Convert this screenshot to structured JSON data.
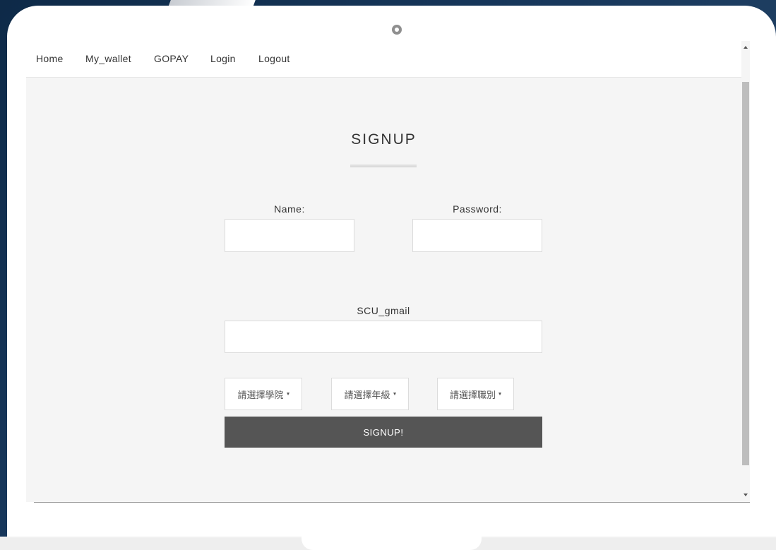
{
  "nav": {
    "items": [
      "Home",
      "My_wallet",
      "GOPAY",
      "Login",
      "Logout"
    ]
  },
  "form": {
    "title": "SIGNUP",
    "name_label": "Name:",
    "name_value": "",
    "password_label": "Password:",
    "password_value": "",
    "email_label": "SCU_gmail",
    "email_value": "",
    "selects": [
      {
        "selected": "請選擇學院"
      },
      {
        "selected": "請選擇年級"
      },
      {
        "selected": "請選擇職別"
      }
    ],
    "submit_label": "SIGNUP!"
  },
  "colors": {
    "button_bg": "#555555",
    "page_bg": "#f5f5f5",
    "background_navy": "#17375b"
  }
}
